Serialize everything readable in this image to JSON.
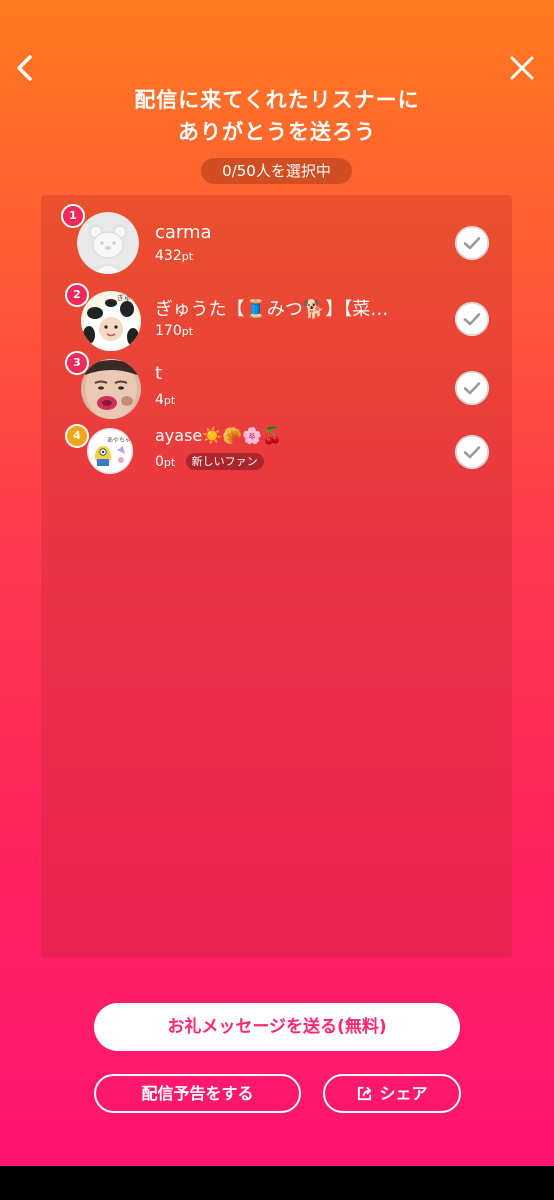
{
  "title": {
    "line1": "配信に来てくれたリスナーに",
    "line2": "ありがとうを送ろう"
  },
  "selection": {
    "status": "0/50人を選択中"
  },
  "listeners": [
    {
      "rank": "1",
      "name": "carma",
      "points": "432",
      "unit": "pt",
      "badge": "",
      "avatar_icon": "bear-placeholder-icon"
    },
    {
      "rank": "2",
      "name": "ぎゅうた【🧵みつ🐕】【菜…",
      "points": "170",
      "unit": "pt",
      "badge": "",
      "avatar_icon": "cow-costume-avatar"
    },
    {
      "rank": "3",
      "name": "t",
      "points": "4",
      "unit": "pt",
      "badge": "",
      "avatar_icon": "face-photo-avatar"
    },
    {
      "rank": "4",
      "name": "ayase☀️🥐🌸🍒",
      "points": "0",
      "unit": "pt",
      "badge": "新しいファン",
      "avatar_icon": "sticker-avatar"
    }
  ],
  "buttons": {
    "send_thanks": "お礼メッセージを送る(無料)",
    "announce": "配信予告をする",
    "share": "シェア"
  },
  "colors": {
    "gradient_top": "#ff7a1f",
    "gradient_bottom": "#ff1273",
    "accent_text": "#ff2970",
    "rank_pink": "#ee2a5c",
    "rank_gold": "#f4a417"
  }
}
